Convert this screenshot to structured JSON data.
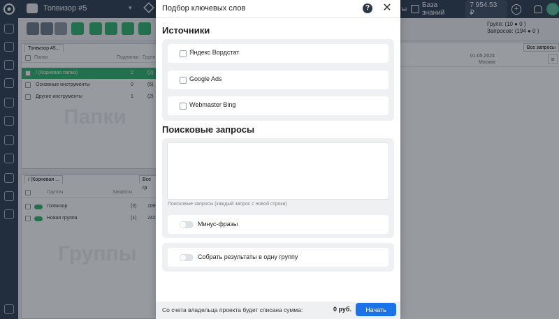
{
  "topbar": {
    "project_name": "Топвизор #5",
    "caret": "▾",
    "knowledge_base": "База знаний",
    "balance": "7 954.53 ₽",
    "plus": "+",
    "partial_label": "ы"
  },
  "stats": {
    "groups_label": "Групп:",
    "groups_value": "(10 ● 0 )",
    "queries_label": "Запросов:",
    "queries_value": "(194 ● 0 )"
  },
  "folders_panel": {
    "tab": "Топвизор #5...",
    "head_label": "Папки",
    "head_sub": "Подпапки",
    "head_groups": "Групп",
    "rows": [
      {
        "label": "/ (Корневая папка)",
        "a": "2",
        "b": "(2)"
      },
      {
        "label": "Основные инструменты",
        "a": "0",
        "b": "(6)"
      },
      {
        "label": "Другие инструменты",
        "a": "1",
        "b": "(2)"
      }
    ],
    "watermark": "Папки"
  },
  "groups_panel": {
    "tab": "/ (Корневая ...",
    "tab2": "Все гр",
    "head_label": "Группы",
    "head_queries": "Запросы",
    "rows": [
      {
        "label": "топвизор",
        "a": "(2)",
        "b": "1090"
      },
      {
        "label": "Новая группа",
        "a": "(1)",
        "b": "242"
      }
    ],
    "watermark": "Группы"
  },
  "right_panel": {
    "tab": "Все запросы",
    "date": "01.05.2024",
    "region": "Москва"
  },
  "modal": {
    "title": "Подбор ключевых слов",
    "help": "?",
    "close": "✕",
    "sources_title": "Источники",
    "sources": [
      {
        "label": "Яндекс Вордстат",
        "checked": false
      },
      {
        "label": "Google Ads",
        "checked": false
      },
      {
        "label": "Webmaster Bing",
        "checked": false
      }
    ],
    "queries_title": "Поисковые запросы",
    "queries_value": "",
    "queries_hint": "Поисковые запросы (каждый запрос с новой строки)",
    "minus_label": "Минус-фразы",
    "collect_label": "Собрать результаты в одну группу",
    "footer_text": "Со счета владельца проекта будет списана сумма:",
    "footer_sum": "0 руб.",
    "start_label": "Начать"
  }
}
